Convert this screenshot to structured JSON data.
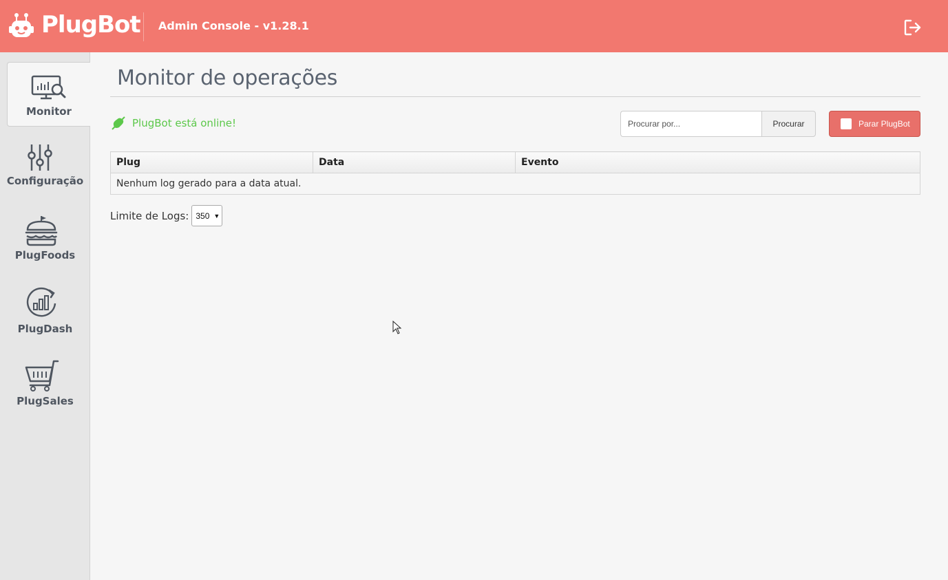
{
  "header": {
    "brand": "PlugBot",
    "console_label": "Admin Console - v1.28.1",
    "logout_icon": "logout-icon"
  },
  "sidebar": {
    "items": [
      {
        "label": "Monitor",
        "icon": "monitor-chart-icon",
        "active": true
      },
      {
        "label": "Configuração",
        "icon": "sliders-icon",
        "active": false
      },
      {
        "label": "PlugFoods",
        "icon": "burger-icon",
        "active": false
      },
      {
        "label": "PlugDash",
        "icon": "dashboard-chart-icon",
        "active": false
      },
      {
        "label": "PlugSales",
        "icon": "shopping-cart-icon",
        "active": false
      }
    ]
  },
  "main": {
    "title": "Monitor de operações",
    "status_text": "PlugBot está online!",
    "search": {
      "placeholder": "Procurar por...",
      "value": "",
      "button_label": "Procurar"
    },
    "stop_button_label": "Parar PlugBot",
    "table": {
      "columns": [
        "Plug",
        "Data",
        "Evento"
      ],
      "empty_message": "Nenhum log gerado para a data atual."
    },
    "limit": {
      "label": "Limite de Logs:",
      "selected": "350"
    }
  },
  "colors": {
    "header_bg": "#f2786f",
    "status_green": "#5cc84a",
    "stop_button_bg": "#e8706a"
  }
}
